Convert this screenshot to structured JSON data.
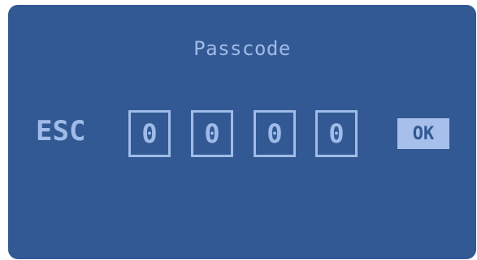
{
  "dialog": {
    "title": "Passcode",
    "esc_label": "ESC",
    "digits": [
      "0",
      "0",
      "0",
      "0"
    ],
    "ok_label": "OK"
  },
  "colors": {
    "panel": "#335994",
    "text": "#9fbbe8",
    "ok_button_bg": "#a7c0eb"
  }
}
